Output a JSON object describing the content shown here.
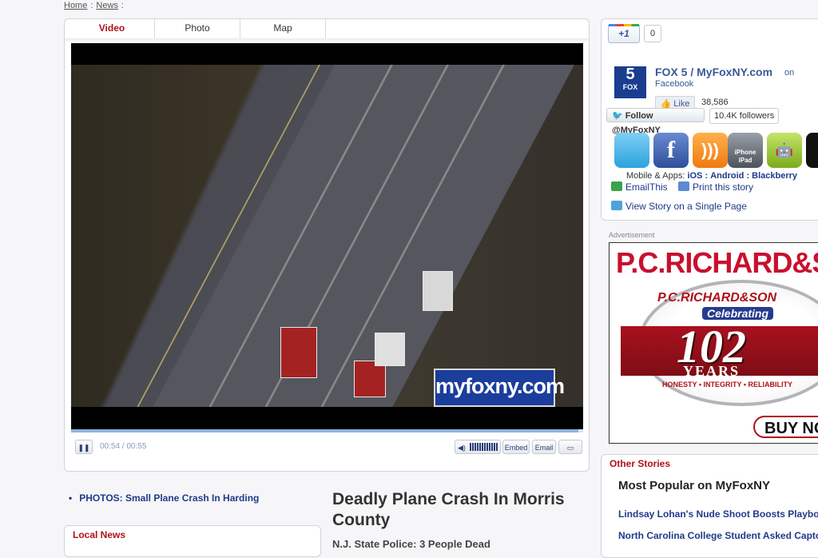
{
  "breadcrumb": {
    "home": "Home",
    "news": "News",
    "sep": ":"
  },
  "tabs": [
    {
      "label": "Video"
    },
    {
      "label": "Photo"
    },
    {
      "label": "Map"
    }
  ],
  "player": {
    "watermark": "myfoxny.com",
    "progress": 0.99,
    "time": "00:54 / 00:55",
    "embed": "Embed",
    "email": "Email"
  },
  "related": {
    "link": "PHOTOS: Small Plane Crash In Harding"
  },
  "local_news": {
    "title": "Local News"
  },
  "article": {
    "headline": "Deadly Plane Crash In Morris County",
    "subhead": "N.J. State Police: 3 People Dead"
  },
  "social": {
    "plus_label": "+1",
    "plus_count": "0",
    "fb_name": "FOX 5 / MyFoxNY.com",
    "fb_on": "on",
    "fb_sub": "Facebook",
    "like_label": "Like",
    "like_count": "38,586",
    "follow_label": "Follow @MyFoxNY",
    "followers": "10.4K followers",
    "apps": {
      "twitter": "twitter",
      "facebook": "f",
      "rss": "rss",
      "iphone": "iPhone iPad",
      "android": "android",
      "blackberry": "bb"
    },
    "mobile_prefix": "Mobile & Apps:",
    "mobile_ios": "iOS",
    "mobile_android": "Android",
    "mobile_blackberry": "Blackberry",
    "colon": ":",
    "email_this": "EmailThis",
    "print_story": "Print this story",
    "single_page": "View Story on a Single Page"
  },
  "ad": {
    "label": "Advertisement",
    "brand": "P.C.RICHARD&SON",
    "arc": "P.C.RICHARD&SON",
    "celebrating": "Celebrating",
    "number": "102",
    "years": "YEARS",
    "motto": "HONESTY • INTEGRITY • RELIABILITY",
    "buy": "BUY NOW"
  },
  "other_stories": {
    "title": "Other Stories",
    "popular": "Most Popular on MyFoxNY",
    "items": [
      "Lindsay Lohan's Nude Shoot Boosts Playboy",
      "North Carolina College Student Asked Captor"
    ]
  },
  "colors": {
    "accent_red": "#b0101a",
    "link_blue": "#1f3a8a",
    "facebook": "#3b5998"
  }
}
